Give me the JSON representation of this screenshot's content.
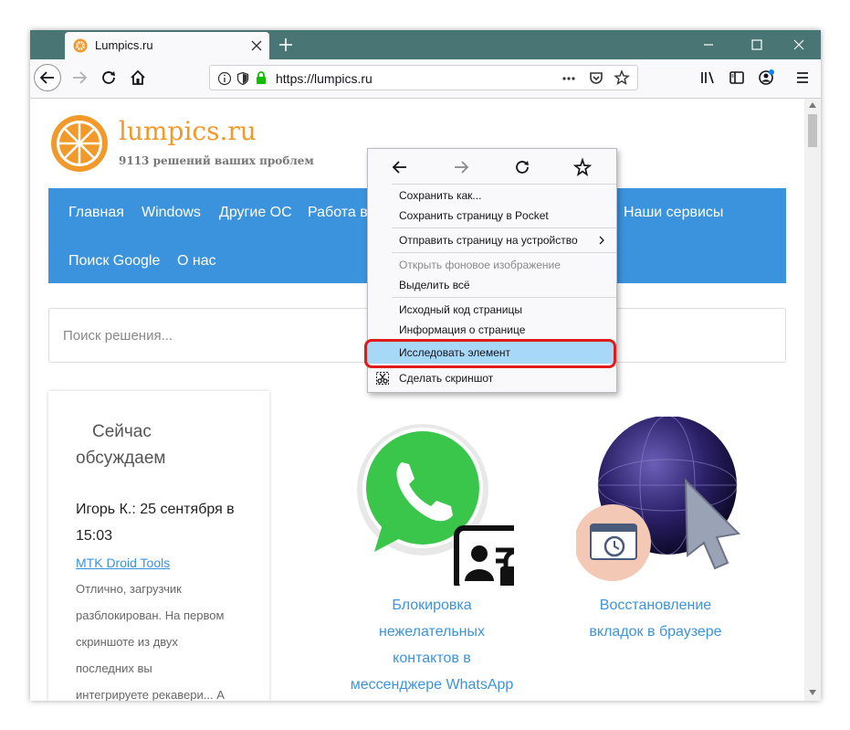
{
  "browser": {
    "tab_title": "Lumpics.ru",
    "url": "https://lumpics.ru"
  },
  "site": {
    "logo_title": "lumpics.ru",
    "logo_subtitle": "9113 решений ваших проблем",
    "menu": [
      "Главная",
      "Windows",
      "Другие ОС",
      "Работа в",
      "Наши сервисы",
      "Поиск Google",
      "О нас"
    ],
    "search_placeholder": "Поиск решения...",
    "sidebar": {
      "title_line1": "Сейчас",
      "title_line2": "обсуждаем",
      "author_line1": "Игорь К.: 25 сентября в",
      "author_line2": "15:03",
      "link": "MTK Droid Tools",
      "comment_lines": [
        "Отлично, загрузчик",
        "разблокирован. На первом",
        "скриншоте из двух",
        "последних вы",
        "интегрируете рекавери... А"
      ]
    },
    "cards": [
      {
        "lines": [
          "Блокировка",
          "нежелательных",
          "контактов в",
          "мессенджере WhatsApp"
        ]
      },
      {
        "lines": [
          "Восстановление",
          "вкладок в браузере"
        ]
      }
    ]
  },
  "context_menu": {
    "items": [
      "Сохранить как...",
      "Сохранить страницу в Pocket",
      "Отправить страницу на устройство",
      "Открыть фоновое изображение",
      "Выделить всё",
      "Исходный код страницы",
      "Информация о странице",
      "Исследовать элемент",
      "Сделать скриншот"
    ]
  },
  "colors": {
    "titlebar": "#4a7575",
    "accent": "#3c93dd",
    "logo_orange": "#f19a2b",
    "highlight_ring": "#e11a1a"
  }
}
